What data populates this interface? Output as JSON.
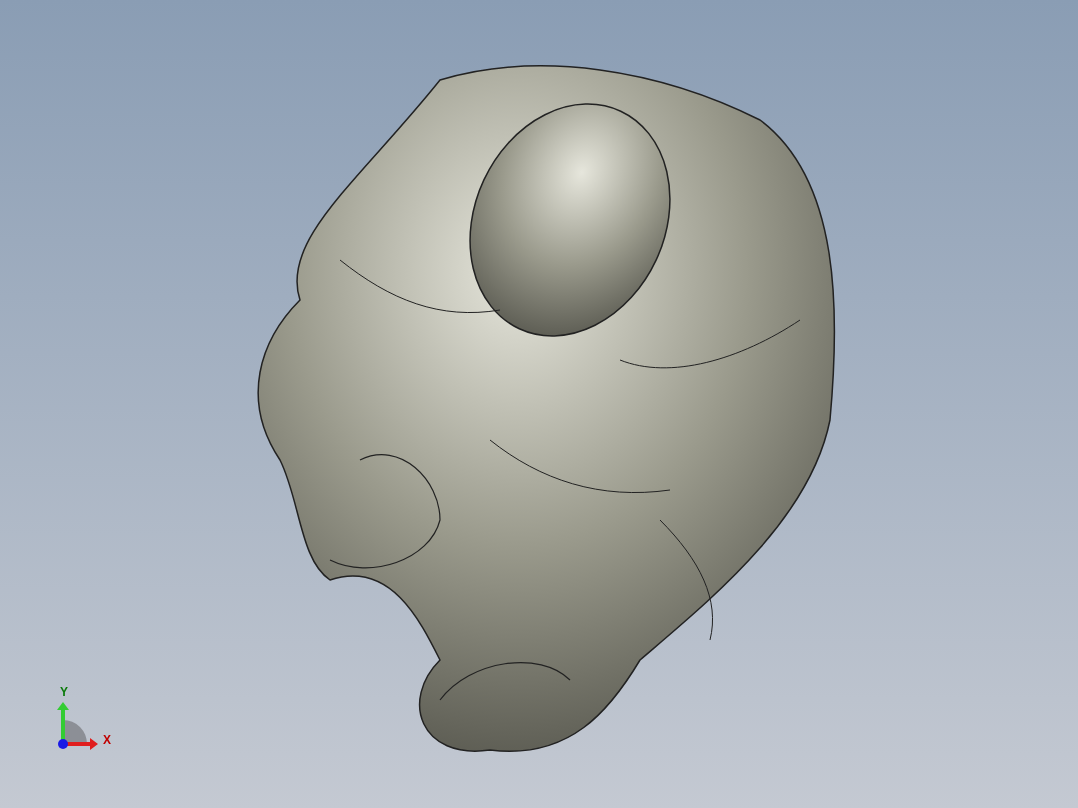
{
  "axis_triad": {
    "axes": [
      {
        "label": "Y",
        "kind": "y"
      },
      {
        "label": "X",
        "kind": "x"
      }
    ]
  }
}
